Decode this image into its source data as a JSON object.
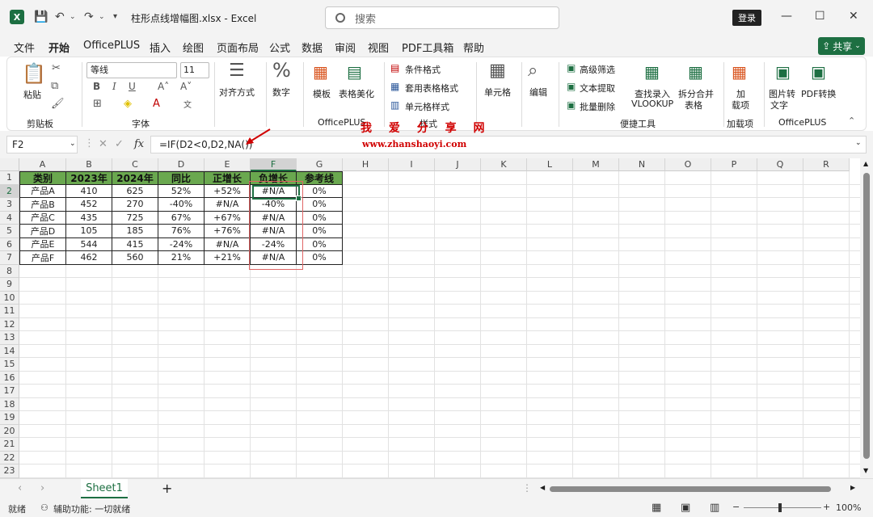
{
  "window": {
    "title": "柱形点线增幅图.xlsx  -  Excel",
    "search_placeholder": "搜索",
    "login_label": "登录"
  },
  "menu": [
    "文件",
    "开始",
    "OfficePLUS",
    "插入",
    "绘图",
    "页面布局",
    "公式",
    "数据",
    "审阅",
    "视图",
    "PDF工具箱",
    "帮助"
  ],
  "share_label": "共享",
  "ribbon": {
    "paste": "粘贴",
    "font_name": "等线",
    "font_size": "11",
    "align": "对齐方式",
    "number": "数字",
    "template": "模板",
    "table_beautify": "表格美化",
    "cond_format": "条件格式",
    "table_format": "套用表格格式",
    "cell_style": "单元格样式",
    "cells": "单元格",
    "edit": "编辑",
    "adv_filter": "高级筛选",
    "text_extract": "文本提取",
    "batch_delete": "批量删除",
    "vlookup_1": "查找录入",
    "vlookup_2": "VLOOKUP",
    "split_1": "拆分合并",
    "split_2": "表格",
    "addin_1": "加",
    "addin_2": "载项",
    "img2text_1": "图片转",
    "img2text_2": "文字",
    "pdf_convert": "PDF转换",
    "groups": {
      "clipboard": "剪贴板",
      "font": "字体",
      "officeplus": "OfficePLUS",
      "style": "样式",
      "tools": "便捷工具",
      "addins": "加载项",
      "officeplus2": "OfficePLUS"
    }
  },
  "formula_bar": {
    "name_box": "F2",
    "formula": "=IF(D2<0,D2,NA())"
  },
  "watermark": {
    "line1": "我 爱 分 享 网",
    "line2": "www.zhanshaoyi.com"
  },
  "columns": [
    "A",
    "B",
    "C",
    "D",
    "E",
    "F",
    "G",
    "H",
    "I",
    "J",
    "K",
    "L",
    "M",
    "N",
    "O",
    "P",
    "Q",
    "R"
  ],
  "rows": [
    "1",
    "2",
    "3",
    "4",
    "5",
    "6",
    "7",
    "8",
    "9",
    "10",
    "11",
    "12",
    "13",
    "14",
    "15",
    "16",
    "17",
    "18",
    "19",
    "20",
    "21",
    "22",
    "23"
  ],
  "table": {
    "headers": [
      "类别",
      "2023年",
      "2024年",
      "同比",
      "正增长",
      "负增长",
      "参考线"
    ],
    "data": [
      [
        "产品A",
        "410",
        "625",
        "52%",
        "+52%",
        "#N/A",
        "0%"
      ],
      [
        "产品B",
        "452",
        "270",
        "-40%",
        "#N/A",
        "-40%",
        "0%"
      ],
      [
        "产品C",
        "435",
        "725",
        "67%",
        "+67%",
        "#N/A",
        "0%"
      ],
      [
        "产品D",
        "105",
        "185",
        "76%",
        "+76%",
        "#N/A",
        "0%"
      ],
      [
        "产品E",
        "544",
        "415",
        "-24%",
        "#N/A",
        "-24%",
        "0%"
      ],
      [
        "产品F",
        "462",
        "560",
        "21%",
        "+21%",
        "#N/A",
        "0%"
      ]
    ]
  },
  "sheet_tab": "Sheet1",
  "status": {
    "ready": "就绪",
    "accessibility": "辅助功能: 一切就绪",
    "zoom": "100%"
  }
}
